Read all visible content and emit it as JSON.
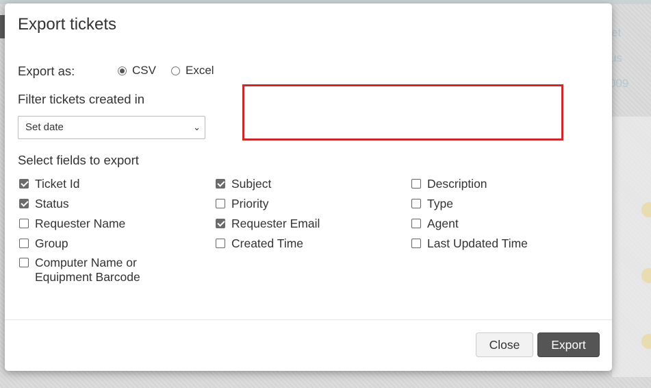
{
  "background": {
    "texts": [
      "et",
      "us",
      "009"
    ]
  },
  "modal": {
    "title": "Export tickets",
    "export_as": {
      "label": "Export as:",
      "options": [
        {
          "label": "CSV",
          "selected": true
        },
        {
          "label": "Excel",
          "selected": false
        }
      ]
    },
    "filter": {
      "label": "Filter tickets created in",
      "selected": "Set date"
    },
    "fields": {
      "label": "Select fields to export",
      "items": [
        {
          "label": "Ticket Id",
          "checked": true
        },
        {
          "label": "Subject",
          "checked": true
        },
        {
          "label": "Description",
          "checked": false
        },
        {
          "label": "Status",
          "checked": true
        },
        {
          "label": "Priority",
          "checked": false
        },
        {
          "label": "Type",
          "checked": false
        },
        {
          "label": "Requester Name",
          "checked": false
        },
        {
          "label": "Requester Email",
          "checked": true
        },
        {
          "label": "Agent",
          "checked": false
        },
        {
          "label": "Group",
          "checked": false
        },
        {
          "label": "Created Time",
          "checked": false
        },
        {
          "label": "Last Updated Time",
          "checked": false
        },
        {
          "label": "Computer Name or Equipment Barcode",
          "checked": false
        }
      ]
    },
    "buttons": {
      "close": "Close",
      "export": "Export"
    },
    "highlight_color": "#cc2a2a"
  }
}
